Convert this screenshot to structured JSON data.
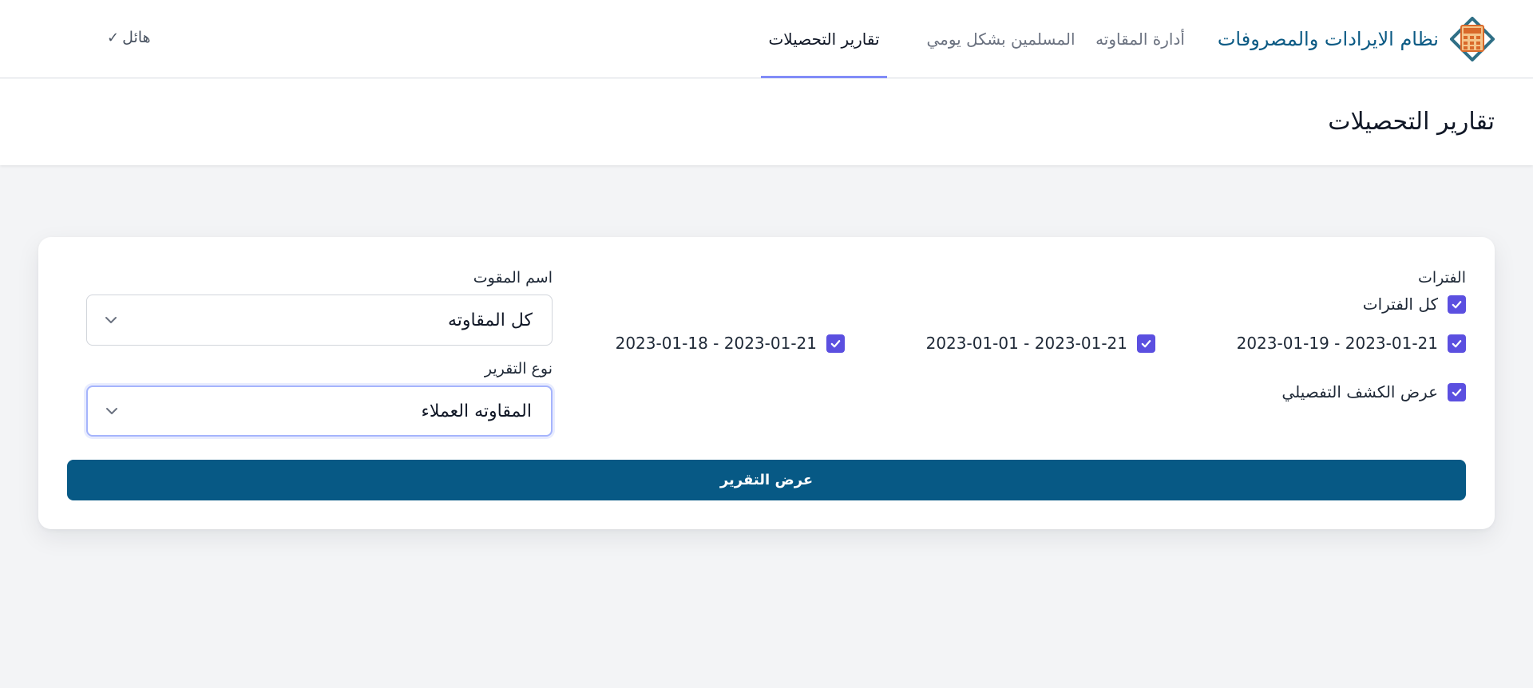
{
  "app": {
    "name": "نظام الايرادات والمصروفات",
    "logo_icon": "calculator-icon"
  },
  "nav": {
    "tabs": [
      {
        "label": "أدارة المقاوته",
        "active": false
      },
      {
        "label": "المسلمين بشكل يومي",
        "active": false
      },
      {
        "label": "تقارير التحصيلات",
        "active": true
      }
    ],
    "user": {
      "name": "هائل",
      "icon": "chevron-down-icon"
    }
  },
  "page": {
    "title": "تقارير التحصيلات"
  },
  "form": {
    "periods_label": "الفترات",
    "all_periods": {
      "label": "كل الفترات",
      "checked": true
    },
    "periods": [
      {
        "label": "2023-01-19 - 2023-01-21",
        "checked": true
      },
      {
        "label": "2023-01-01 - 2023-01-21",
        "checked": true
      },
      {
        "label": "2023-01-18 - 2023-01-21",
        "checked": true
      }
    ],
    "detailed": {
      "label": "عرض الكشف التفصيلي",
      "checked": true
    },
    "moqawet": {
      "label": "اسم المقوت",
      "value": "كل المقاوته"
    },
    "report_type": {
      "label": "نوع التقرير",
      "value": "المقاوته العملاء"
    },
    "submit_label": "عرض التقرير"
  },
  "colors": {
    "brand": "#0b5a84",
    "accent": "#5b4fe0",
    "button": "#075985",
    "tab_underline": "#818cf8"
  }
}
